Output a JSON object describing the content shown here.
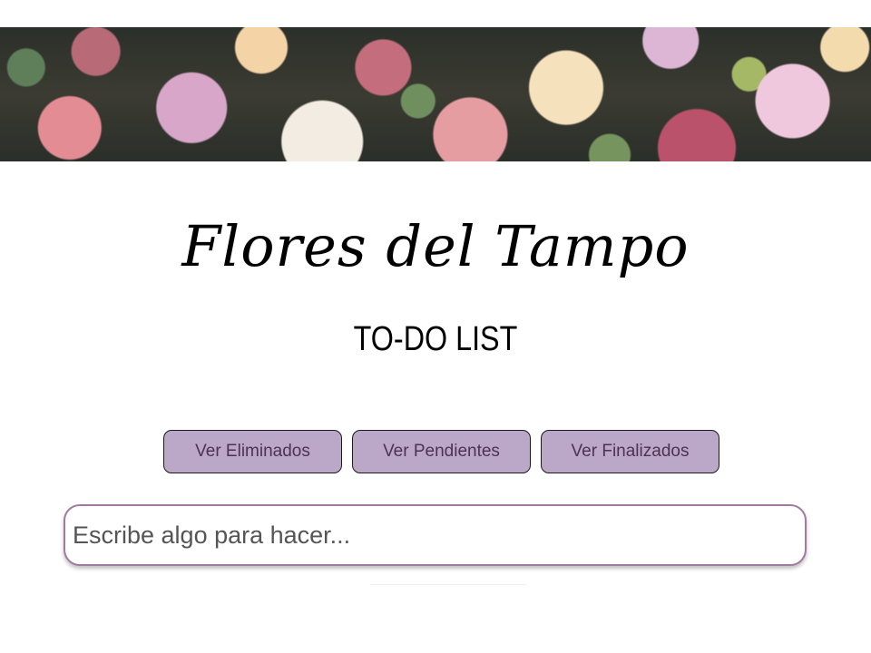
{
  "header": {
    "title": "Flores del Tampo",
    "subtitle": "TO-DO LIST"
  },
  "filters": [
    {
      "label": "Ver Eliminados"
    },
    {
      "label": "Ver Pendientes"
    },
    {
      "label": "Ver Finalizados"
    }
  ],
  "task_input": {
    "value": "",
    "placeholder": "Escribe algo para hacer..."
  },
  "colors": {
    "button_bg": "#bba7c7",
    "button_text": "#4d3352",
    "input_border": "#a27a9d"
  }
}
